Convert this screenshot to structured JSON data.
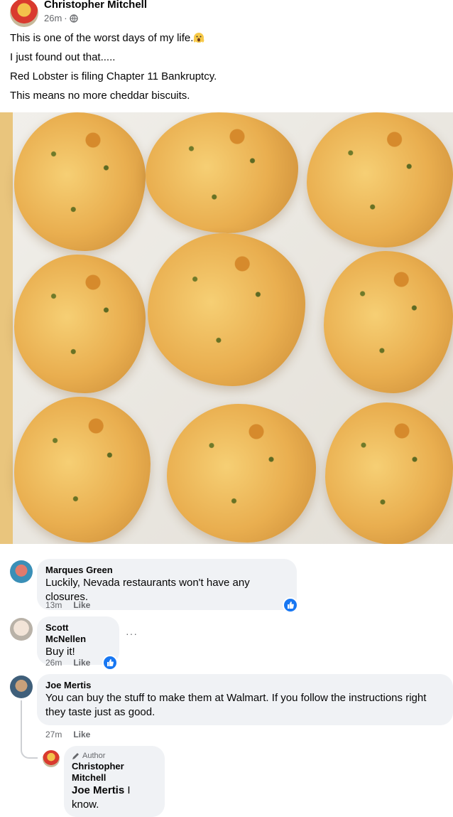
{
  "post": {
    "author": "Christopher Mitchell",
    "time": "26m",
    "separator": "·",
    "privacy_icon": "globe-icon",
    "lines": [
      "This is one of the worst days of my life.",
      "I just found out that.....",
      "Red Lobster is filing Chapter 11 Bankruptcy.",
      "This means no more cheddar biscuits."
    ],
    "emoji_icon": "screaming-face-icon"
  },
  "comments": [
    {
      "name": "Marques Green",
      "text": "Luckily, Nevada restaurants won't have any closures.",
      "time": "13m",
      "like_label": "Like",
      "reaction": "like-reaction-icon"
    },
    {
      "name": "Scott McNellen",
      "text": "Buy it!",
      "time": "26m",
      "like_label": "Like",
      "reaction": "like-reaction-icon",
      "more": "···"
    },
    {
      "name": "Joe Mertis",
      "text": "You can buy the stuff to make them at Walmart. If you follow the instructions right they taste just as good.",
      "time": "27m",
      "like_label": "Like",
      "reaction": "like-reaction-icon"
    }
  ],
  "reply": {
    "badge": "Author",
    "badge_icon": "pencil-icon",
    "name": "Christopher Mitchell",
    "mention": "Joe Mertis",
    "text": " I know."
  },
  "colors": {
    "accent": "#1877f2",
    "bubble": "#f0f2f5",
    "muted": "#65676b"
  }
}
